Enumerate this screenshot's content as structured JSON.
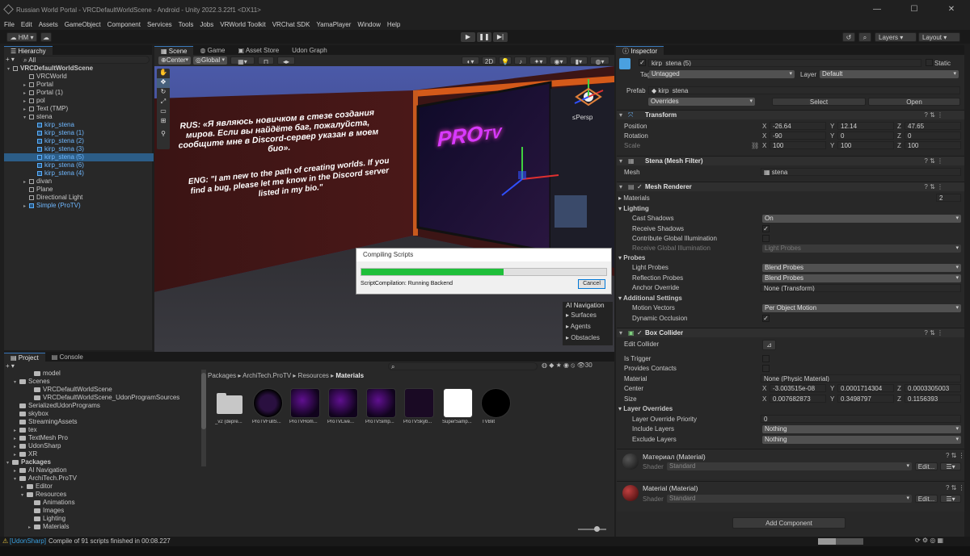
{
  "window": {
    "title": "Russian World Portal - VRCDefaultWorldScene - Android - Unity 2022.3.22f1 <DX11>",
    "controls": [
      "—",
      "☐",
      "✕"
    ]
  },
  "menu": [
    "File",
    "Edit",
    "Assets",
    "GameObject",
    "Component",
    "Services",
    "Tools",
    "Jobs",
    "VRWorld Toolkit",
    "VRChat SDK",
    "YamaPlayer",
    "Window",
    "Help"
  ],
  "toolbar": {
    "account": "HM",
    "layers": "Layers",
    "layout": "Layout"
  },
  "hierarchy": {
    "tab": "Hierarchy",
    "search_placeholder": "All",
    "items": [
      {
        "label": "VRCDefaultWorldScene",
        "indent": 0,
        "tri": "▾",
        "kind": "scene"
      },
      {
        "label": "VRCWorld",
        "indent": 2,
        "tri": "",
        "kind": "obj"
      },
      {
        "label": "Portal",
        "indent": 2,
        "tri": "▸",
        "kind": "obj"
      },
      {
        "label": "Portal (1)",
        "indent": 2,
        "tri": "▸",
        "kind": "obj"
      },
      {
        "label": "pol",
        "indent": 2,
        "tri": "▸",
        "kind": "obj"
      },
      {
        "label": "Text (TMP)",
        "indent": 2,
        "tri": "▸",
        "kind": "obj"
      },
      {
        "label": "stena",
        "indent": 2,
        "tri": "▾",
        "kind": "obj"
      },
      {
        "label": "kirp_stena",
        "indent": 3,
        "tri": "",
        "kind": "prefab"
      },
      {
        "label": "kirp_stena (1)",
        "indent": 3,
        "tri": "",
        "kind": "prefab"
      },
      {
        "label": "kirp_stena (2)",
        "indent": 3,
        "tri": "",
        "kind": "prefab"
      },
      {
        "label": "kirp_stena (3)",
        "indent": 3,
        "tri": "",
        "kind": "prefab"
      },
      {
        "label": "kirp_stena (5)",
        "indent": 3,
        "tri": "",
        "kind": "prefab",
        "selected": true
      },
      {
        "label": "kirp_stena (6)",
        "indent": 3,
        "tri": "",
        "kind": "prefab"
      },
      {
        "label": "kirp_stena (4)",
        "indent": 3,
        "tri": "",
        "kind": "prefab"
      },
      {
        "label": "divan",
        "indent": 2,
        "tri": "▸",
        "kind": "obj"
      },
      {
        "label": "Plane",
        "indent": 2,
        "tri": "",
        "kind": "obj"
      },
      {
        "label": "Directional Light",
        "indent": 2,
        "tri": "",
        "kind": "obj"
      },
      {
        "label": "Simple (ProTV)",
        "indent": 2,
        "tri": "▸",
        "kind": "prefab"
      }
    ]
  },
  "scene": {
    "tabs": [
      "Scene",
      "Game",
      "Asset Store",
      "Udon Graph"
    ],
    "pivot": "Center",
    "space": "Global",
    "mode_2d": "2D",
    "persp": "≤Persp",
    "text_rus": "RUS: «Я являюсь новичком в стезе создания миров. Если вы найдёте баг, пожалуйста, сообщите мне в Discord-сервер указан в моем био».",
    "text_eng": "ENG: \"I am new to the path of creating worlds. If you find a bug, please let me know in the Discord server listed in my bio.\"",
    "logo_main": "PRO",
    "logo_sub": "TV",
    "nav": {
      "title": "AI Navigation",
      "items": [
        "Surfaces",
        "Agents",
        "Obstacles"
      ]
    }
  },
  "dialog": {
    "title": "Compiling Scripts",
    "progress": 0.58,
    "status": "ScriptCompilation: Running Backend",
    "cancel": "Cancel"
  },
  "project": {
    "tabs": [
      "Project",
      "Console"
    ],
    "count": "30",
    "breadcrumb": [
      "Packages",
      "ArchiTech.ProTV",
      "Resources",
      "Materials"
    ],
    "tree": [
      {
        "label": "model",
        "indent": 3
      },
      {
        "label": "Scenes",
        "indent": 1,
        "tri": "▾"
      },
      {
        "label": "VRCDefaultWorldScene",
        "indent": 3
      },
      {
        "label": "VRCDefaultWorldScene_UdonProgramSources",
        "indent": 3
      },
      {
        "label": "SerializedUdonPrograms",
        "indent": 1
      },
      {
        "label": "skybox",
        "indent": 1
      },
      {
        "label": "StreamingAssets",
        "indent": 1
      },
      {
        "label": "tex",
        "indent": 1,
        "tri": "▸"
      },
      {
        "label": "TextMesh Pro",
        "indent": 1,
        "tri": "▸"
      },
      {
        "label": "UdonSharp",
        "indent": 1,
        "tri": "▸"
      },
      {
        "label": "XR",
        "indent": 1,
        "tri": "▸"
      },
      {
        "label": "Packages",
        "indent": 0,
        "tri": "▾",
        "bold": true
      },
      {
        "label": "AI Navigation",
        "indent": 1,
        "tri": "▸"
      },
      {
        "label": "ArchiTech.ProTV",
        "indent": 1,
        "tri": "▾"
      },
      {
        "label": "Editor",
        "indent": 2,
        "tri": "▸"
      },
      {
        "label": "Resources",
        "indent": 2,
        "tri": "▾"
      },
      {
        "label": "Animations",
        "indent": 3
      },
      {
        "label": "Images",
        "indent": 3
      },
      {
        "label": "Lighting",
        "indent": 3
      },
      {
        "label": "Materials",
        "indent": 3,
        "tri": "▸"
      }
    ],
    "assets": [
      {
        "label": "_v2 (depre...",
        "kind": "folder"
      },
      {
        "label": "ProTVFullS...",
        "kind": "logo"
      },
      {
        "label": "ProTVHom...",
        "kind": "sphere"
      },
      {
        "label": "ProTVLive...",
        "kind": "sphere"
      },
      {
        "label": "ProTVSimp...",
        "kind": "sphere"
      },
      {
        "label": "ProTVSkyb...",
        "kind": "dark"
      },
      {
        "label": "SuperSamp...",
        "kind": "white"
      },
      {
        "label": "TVBlit",
        "kind": "black"
      }
    ]
  },
  "inspector": {
    "tab": "Inspector",
    "name": "kirp_stena (5)",
    "static": "Static",
    "tag_label": "Tag",
    "tag": "Untagged",
    "layer_label": "Layer",
    "layer": "Default",
    "prefab_label": "Prefab",
    "prefab": "kirp_stena",
    "overrides": "Overrides",
    "select": "Select",
    "open": "Open",
    "transform": {
      "title": "Transform",
      "position_label": "Position",
      "position": [
        "-26.64",
        "12.14",
        "47.65"
      ],
      "rotation_label": "Rotation",
      "rotation": [
        "-90",
        "0",
        "0"
      ],
      "scale_label": "Scale",
      "scale": [
        "100",
        "100",
        "100"
      ]
    },
    "mesh_filter": {
      "title": "Stena (Mesh Filter)",
      "mesh_label": "Mesh",
      "mesh": "stena"
    },
    "mesh_renderer": {
      "title": "Mesh Renderer",
      "materials_label": "Materials",
      "materials_count": "2",
      "lighting": "Lighting",
      "cast_label": "Cast Shadows",
      "cast": "On",
      "receive_label": "Receive Shadows",
      "contribute_label": "Contribute Global Illumination",
      "receive_gi_label": "Receive Global Illumination",
      "receive_gi": "Light Probes",
      "probes": "Probes",
      "light_probes_label": "Light Probes",
      "light_probes": "Blend Probes",
      "reflection_label": "Reflection Probes",
      "reflection": "Blend Probes",
      "anchor_label": "Anchor Override",
      "anchor": "None (Transform)",
      "additional": "Additional Settings",
      "motion_label": "Motion Vectors",
      "motion": "Per Object Motion",
      "occlusion_label": "Dynamic Occlusion"
    },
    "box_collider": {
      "title": "Box Collider",
      "edit_label": "Edit Collider",
      "trigger_label": "Is Trigger",
      "contacts_label": "Provides Contacts",
      "material_label": "Material",
      "material": "None (Physic Material)",
      "center_label": "Center",
      "center": [
        "-3.003515e-08",
        "0.0001714304",
        "0.0003305003"
      ],
      "size_label": "Size",
      "size": [
        "0.007682873",
        "0.3498797",
        "0.1156393"
      ],
      "layer_overrides": "Layer Overrides",
      "priority_label": "Layer Override Priority",
      "priority": "0",
      "include_label": "Include Layers",
      "include": "Nothing",
      "exclude_label": "Exclude Layers",
      "exclude": "Nothing"
    },
    "materials": [
      {
        "name": "Материал (Material)",
        "shader_label": "Shader",
        "shader": "Standard",
        "edit": "Edit..."
      },
      {
        "name": "Material (Material)",
        "shader_label": "Shader",
        "shader": "Standard",
        "edit": "Edit..."
      }
    ],
    "add_component": "Add Component"
  },
  "status": {
    "tag": "[UdonSharp]",
    "text": "Compile of 91 scripts finished in 00:08.227"
  },
  "colors": {
    "accent": "#3a79bb",
    "progress": "#1fbf3a",
    "selection": "#2c5d87"
  }
}
